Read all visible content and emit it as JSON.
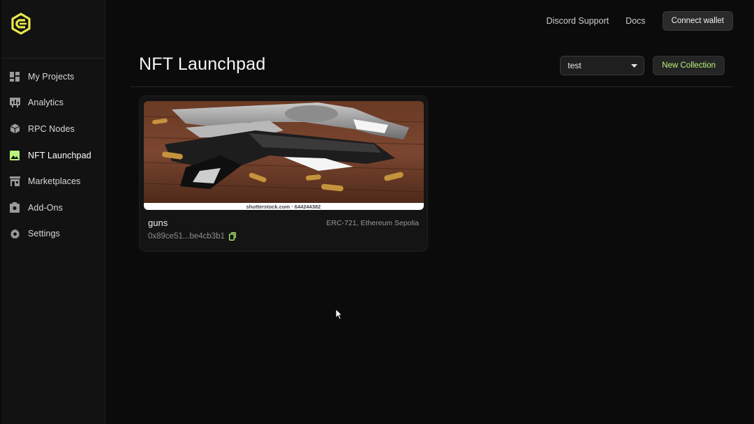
{
  "sidebar": {
    "logo_icon": "brand-logo-icon",
    "items": [
      {
        "label": "My Projects",
        "icon": "dashboard-grid-icon",
        "active": false
      },
      {
        "label": "Analytics",
        "icon": "chart-board-icon",
        "active": false
      },
      {
        "label": "RPC Nodes",
        "icon": "cube-icon",
        "active": false
      },
      {
        "label": "NFT Launchpad",
        "icon": "image-icon",
        "active": true
      },
      {
        "label": "Marketplaces",
        "icon": "storefront-icon",
        "active": false
      },
      {
        "label": "Add-Ons",
        "icon": "addon-box-icon",
        "active": false
      },
      {
        "label": "Settings",
        "icon": "gear-icon",
        "active": false
      }
    ]
  },
  "header": {
    "discord_label": "Discord Support",
    "docs_label": "Docs",
    "connect_label": "Connect wallet"
  },
  "page": {
    "title": "NFT Launchpad",
    "select_value": "test",
    "new_collection_label": "New Collection"
  },
  "collections": [
    {
      "name": "guns",
      "meta": "ERC-721, Ethereum Sepolia",
      "address": "0x89ce51...be4cb3b1",
      "image_watermark": "shutterstock.com · 644244382"
    }
  ],
  "colors": {
    "accent": "#b9f27c",
    "logo": "#e9e84a",
    "background": "#0b0b0b",
    "sidebar": "#121212"
  }
}
